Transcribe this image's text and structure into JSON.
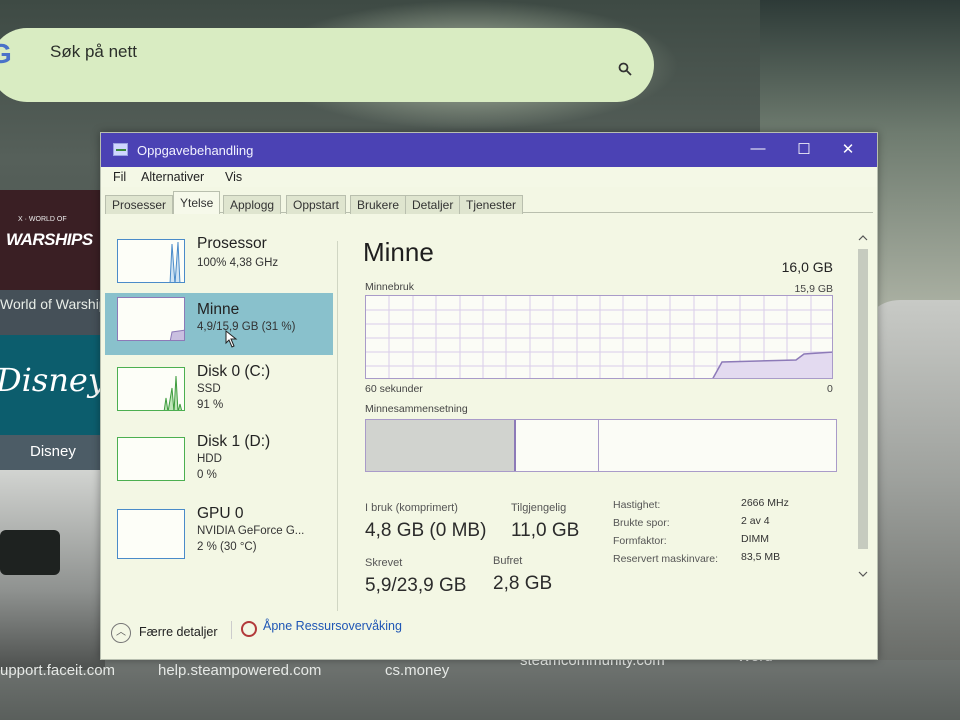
{
  "search": {
    "text": "Søk på nett",
    "logo": "G"
  },
  "tiles": {
    "warships_sub": "X · WORLD OF",
    "warships_title": "WARSHIPS",
    "warships_label": "World of Warships",
    "disney_logo": "Disney+",
    "disney_label": "Disney"
  },
  "dock": [
    "upport.faceit.com",
    "help.steampowered.com",
    "cs.money",
    "steamcommunity.com",
    "Word"
  ],
  "window": {
    "title": "Oppgavebehandling",
    "controls": {
      "minimize": "—",
      "maximize": "☐",
      "close": "✕"
    },
    "menu": [
      "Fil",
      "Alternativer",
      "Vis"
    ],
    "tabs": [
      "Prosesser",
      "Ytelse",
      "Applogg",
      "Oppstart",
      "Brukere",
      "Detaljer",
      "Tjenester"
    ],
    "active_tab": "Ytelse"
  },
  "sidebar": [
    {
      "name": "Prosessor",
      "line1": "100%  4,38 GHz",
      "line2": ""
    },
    {
      "name": "Minne",
      "line1": "4,9/15,9 GB (31 %)",
      "line2": ""
    },
    {
      "name": "Disk 0 (C:)",
      "line1": "SSD",
      "line2": "91 %"
    },
    {
      "name": "Disk 1 (D:)",
      "line1": "HDD",
      "line2": "0 %"
    },
    {
      "name": "GPU 0",
      "line1": "NVIDIA GeForce G...",
      "line2": "2 %  (30 °C)"
    }
  ],
  "memory": {
    "title": "Minne",
    "total": "16,0 GB",
    "usage_label": "Minnebruk",
    "usage_max": "15,9 GB",
    "time_label": "60 sekunder",
    "time_zero": "0",
    "composition_label": "Minnesammensetning",
    "stats": [
      {
        "label": "I bruk (komprimert)",
        "value": "4,8 GB (0 MB)"
      },
      {
        "label": "Tilgjengelig",
        "value": "11,0 GB"
      },
      {
        "label": "Skrevet",
        "value": "5,9/23,9 GB"
      },
      {
        "label": "Bufret",
        "value": "2,8 GB"
      }
    ],
    "details": [
      {
        "key": "Hastighet:",
        "value": "2666 MHz"
      },
      {
        "key": "Brukte spor:",
        "value": "2 av 4"
      },
      {
        "key": "Formfaktor:",
        "value": "DIMM"
      },
      {
        "key": "Reservert maskinvare:",
        "value": "83,5 MB"
      }
    ]
  },
  "footer": {
    "fewer": "Færre detaljer",
    "open_monitor": "Åpne Ressursovervåking"
  },
  "colors": {
    "titlebar": "#4b42b4",
    "selected": "#89c1cc",
    "memory_line": "#8d7ab8",
    "link": "#1f56b5"
  }
}
